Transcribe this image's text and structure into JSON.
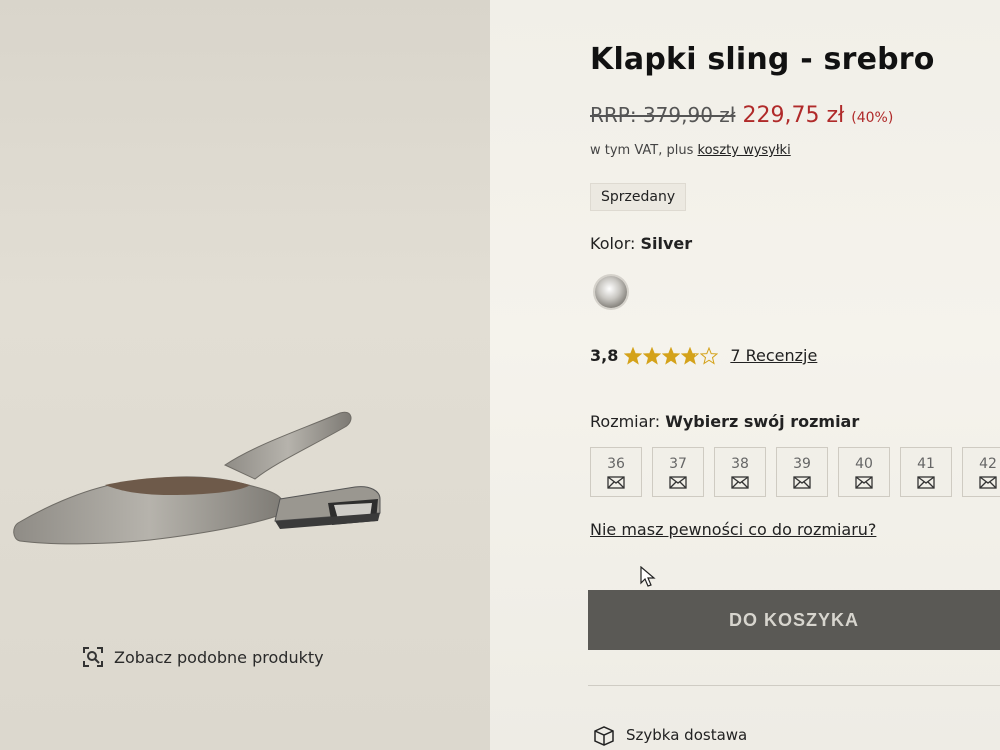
{
  "product": {
    "title": "Klapki sling - srebro",
    "rrp": "RRP: 379,90 zł",
    "sale_price": "229,75 zł",
    "discount": "(40%)",
    "vat_prefix": "w tym VAT, plus",
    "shipping_link": "koszty wysyłki",
    "sold_badge": "Sprzedany",
    "color_prefix": "Kolor:",
    "color_value": "Silver",
    "rating_score": "3,8",
    "rating_value": 3.8,
    "reviews_link": "7 Recenzje",
    "size_prefix": "Rozmiar:",
    "size_value": "Wybierz swój rozmiar",
    "sizes": [
      "36",
      "37",
      "38",
      "39",
      "40",
      "41",
      "42"
    ],
    "size_help": "Nie masz pewności co do rozmiaru?",
    "cart_button": "DO KOSZYKA",
    "fast_delivery": "Szybka dostawa",
    "similar_products": "Zobacz podobne produkty"
  },
  "colors": {
    "sale": "#b02a2a",
    "star": "#d4a21a",
    "button_bg": "#5a5955",
    "button_text": "#d7d5ce"
  },
  "icons": [
    "search-similar-icon",
    "star-icon",
    "mail-icon",
    "box-icon",
    "cursor-icon"
  ]
}
